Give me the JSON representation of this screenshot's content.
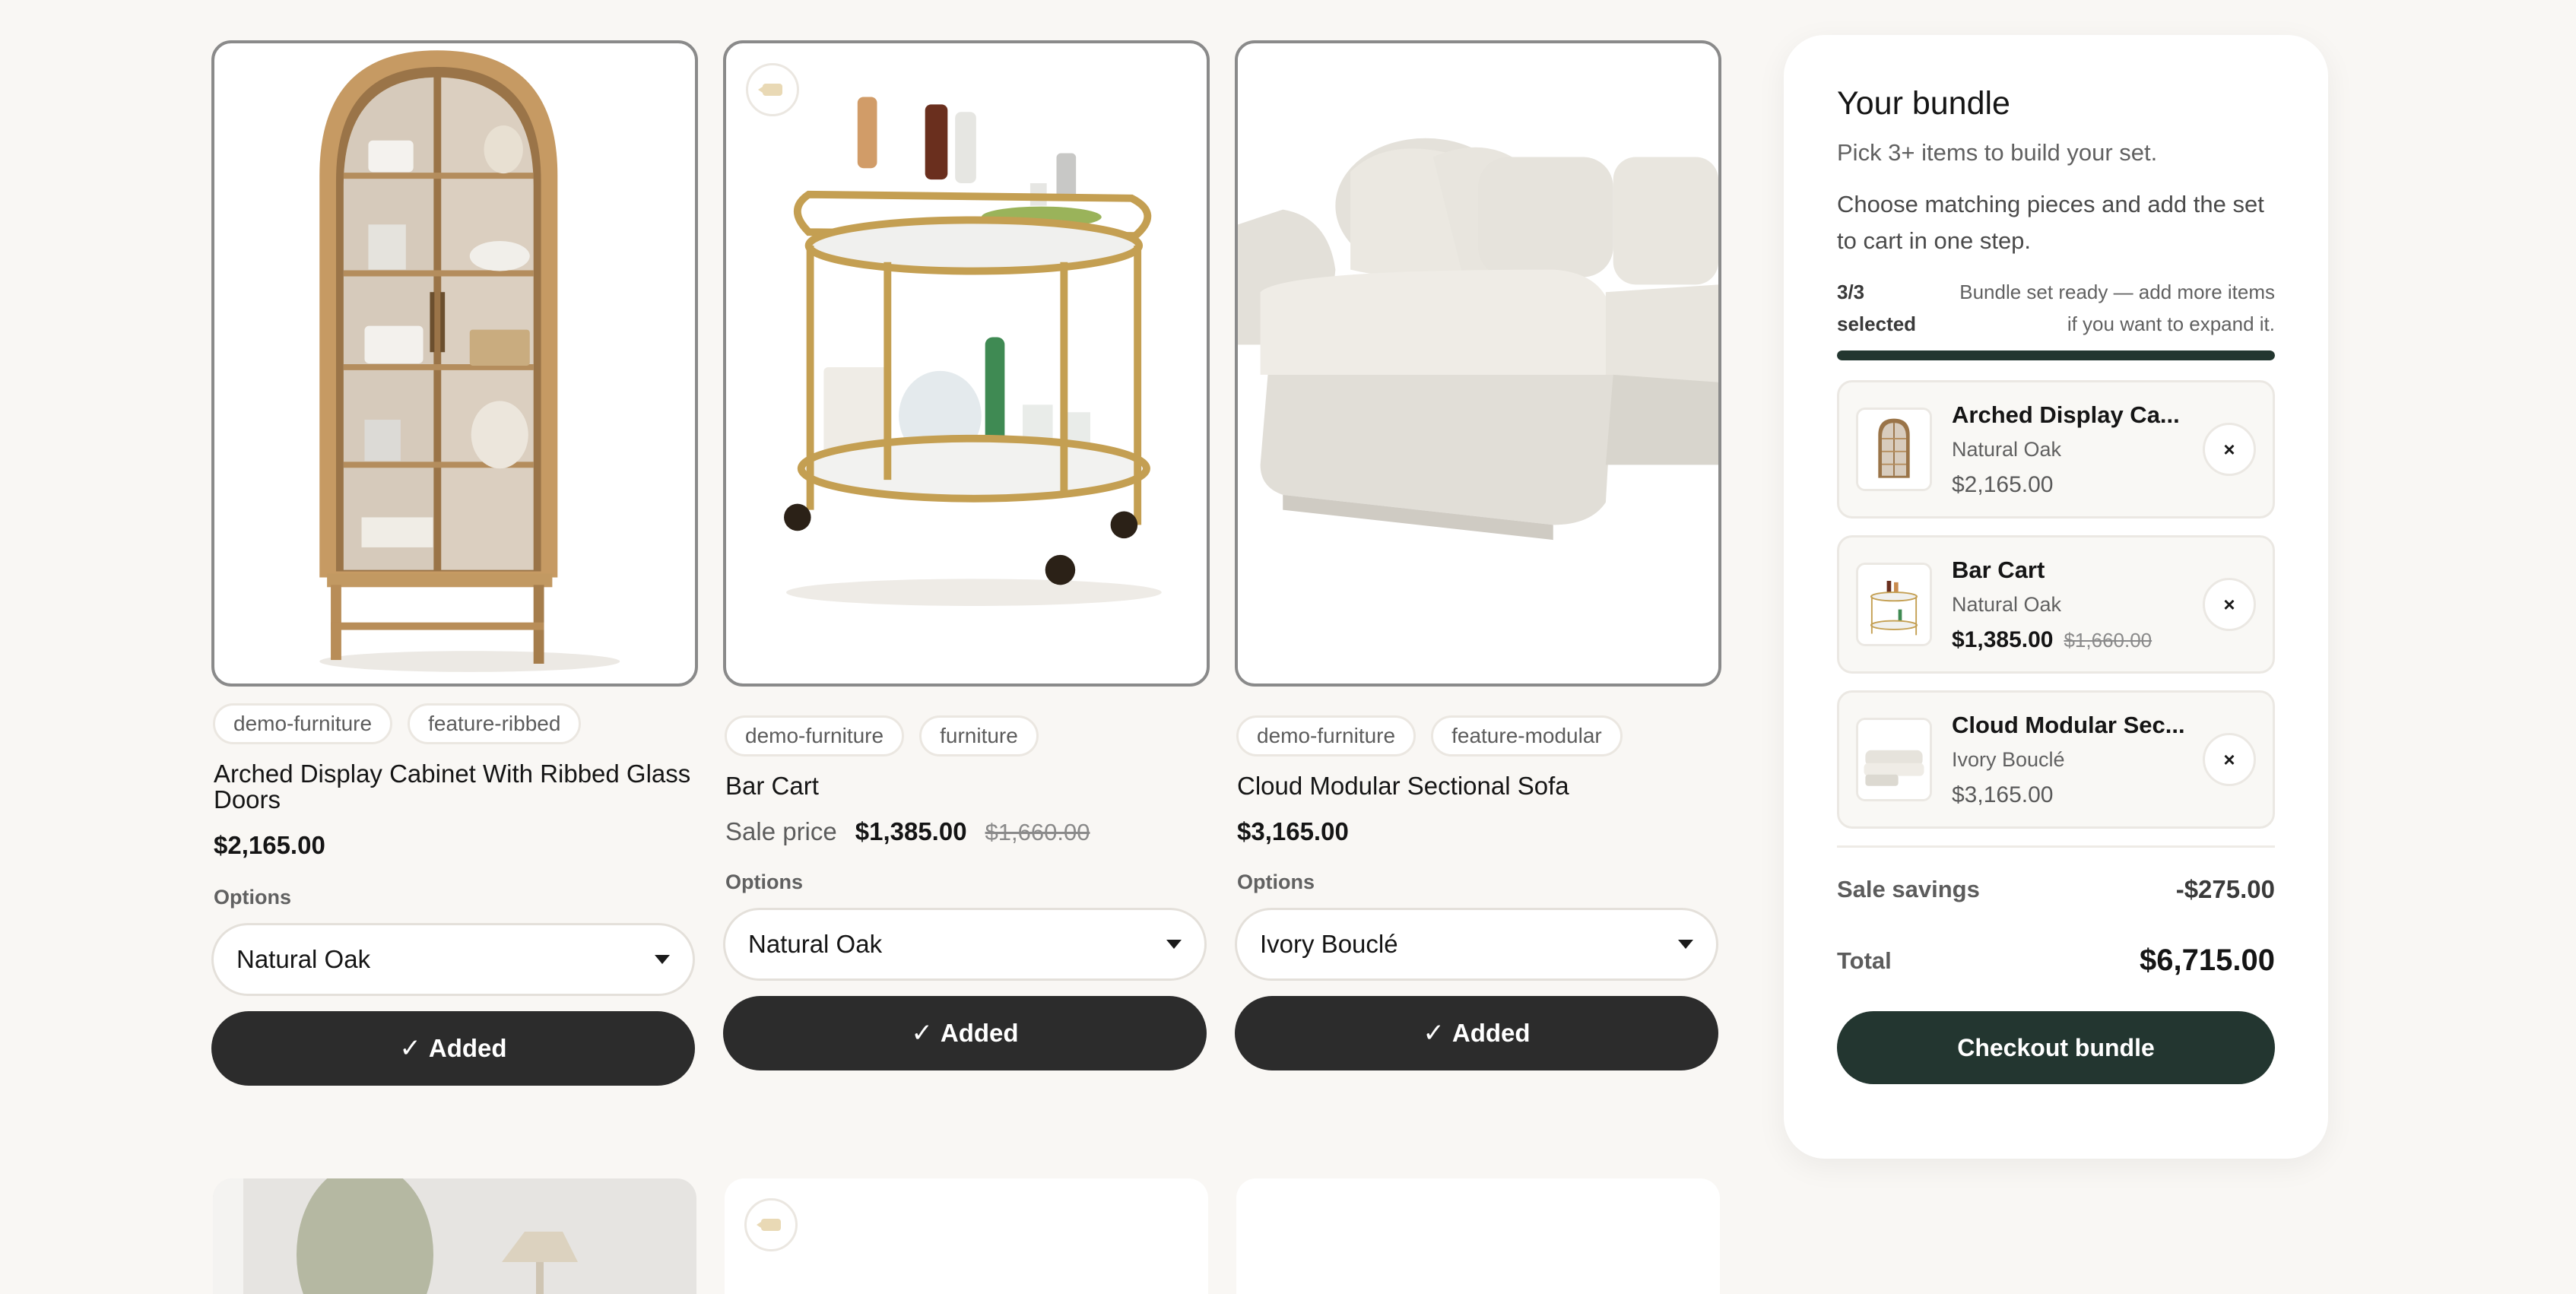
{
  "products": [
    {
      "tags": [
        "demo-furniture",
        "feature-ribbed"
      ],
      "title": "Arched Display Cabinet With Ribbed Glass Doors",
      "price": "$2,165.00",
      "options_label": "Options",
      "option_value": "Natural Oak",
      "button_label": "Added",
      "button_icon": "✓"
    },
    {
      "tags": [
        "demo-furniture",
        "furniture"
      ],
      "title": "Bar Cart",
      "sale_label": "Sale price",
      "price": "$1,385.00",
      "compare_price": "$1,660.00",
      "options_label": "Options",
      "option_value": "Natural Oak",
      "button_label": "Added",
      "button_icon": "✓"
    },
    {
      "tags": [
        "demo-furniture",
        "feature-modular"
      ],
      "title": "Cloud Modular Sectional Sofa",
      "price": "$3,165.00",
      "options_label": "Options",
      "option_value": "Ivory Bouclé",
      "button_label": "Added",
      "button_icon": "✓"
    }
  ],
  "bundle": {
    "title": "Your bundle",
    "subtitle": "Pick 3+ items to build your set.",
    "description": "Choose matching pieces and add the set to cart in one step.",
    "progress": {
      "count": "3/3",
      "count_suffix": "selected",
      "note": "Bundle set ready — add more items if you want to expand it.",
      "fraction": 1.0
    },
    "items": [
      {
        "name": "Arched Display Ca...",
        "variant": "Natural Oak",
        "price": "$2,165.00",
        "remove": "×"
      },
      {
        "name": "Bar Cart",
        "variant": "Natural Oak",
        "price": "$1,385.00",
        "compare_price": "$1,660.00",
        "remove": "×"
      },
      {
        "name": "Cloud Modular Sec...",
        "variant": "Ivory Bouclé",
        "price": "$3,165.00",
        "remove": "×"
      }
    ],
    "savings_label": "Sale savings",
    "savings_value": "-$275.00",
    "total_label": "Total",
    "total_value": "$6,715.00",
    "checkout_label": "Checkout bundle"
  },
  "colors": {
    "accent": "#233630",
    "button_dark": "#2c2c2c",
    "page_bg": "#f9f7f4"
  }
}
